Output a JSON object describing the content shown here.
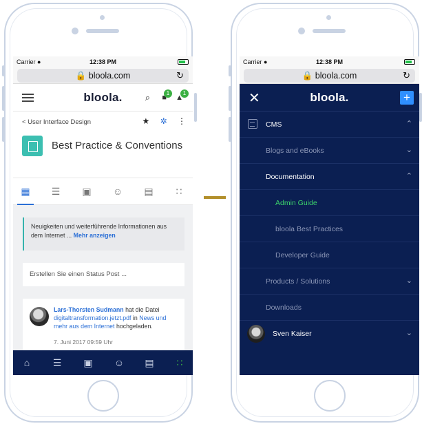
{
  "browser": {
    "carrier": "Carrier ●",
    "time": "12:38 PM",
    "url": "🔒 bloola.com",
    "reload": "↻"
  },
  "left_screen": {
    "logo": "bloola.",
    "header_icons": {
      "search": "⌕",
      "chat": "■",
      "chat_badge": "1",
      "bell": "▲",
      "bell_badge": "1"
    },
    "breadcrumb": "< User Interface Design",
    "crumb_icons": {
      "star": "★",
      "pin": "✲",
      "more": "⋮"
    },
    "page_title": "Best Practice & Conventions",
    "tabs": [
      {
        "icon": "dashboard-icon",
        "glyph": "▦"
      },
      {
        "icon": "list-icon",
        "glyph": "☰"
      },
      {
        "icon": "calendar-icon",
        "glyph": "▣"
      },
      {
        "icon": "people-icon",
        "glyph": "☺"
      },
      {
        "icon": "document-icon",
        "glyph": "▤"
      },
      {
        "icon": "apps-icon",
        "glyph": "∷"
      }
    ],
    "notice": {
      "text": "Neuigkeiten und weiterführende Informationen aus dem Internet ...",
      "link": "Mehr anzeigen"
    },
    "status_input_placeholder": "Erstellen Sie einen Status Post ...",
    "post": {
      "author": "Lars-Thorsten Sudmann",
      "text1": " hat die Datei ",
      "file": "digitaltransformation.jetzt.pdf",
      "text2": " in ",
      "target": "News und mehr aus dem Internet",
      "text3": " hochgeladen.",
      "date": "7. Juni 2017 09:59 Uhr"
    },
    "bottom_tabs": [
      {
        "icon": "home-icon",
        "glyph": "⌂"
      },
      {
        "icon": "list-icon",
        "glyph": "☰"
      },
      {
        "icon": "calendar-icon",
        "glyph": "▣"
      },
      {
        "icon": "people-icon",
        "glyph": "☺"
      },
      {
        "icon": "document-icon",
        "glyph": "▤"
      },
      {
        "icon": "apps-icon",
        "glyph": "∷"
      }
    ]
  },
  "right_screen": {
    "logo": "bloola.",
    "close": "✕",
    "plus": "+",
    "menu": {
      "cms": "CMS",
      "blogs": "Blogs and eBooks",
      "documentation": "Documentation",
      "admin_guide": "Admin Guide",
      "best_practices": "bloola Best Practices",
      "developer_guide": "Developer Guide",
      "products": "Products / Solutions",
      "downloads": "Downloads",
      "user": "Sven Kaiser"
    },
    "chevron_up": "⌃",
    "chevron_down": "⌄"
  },
  "colors": {
    "navy": "#0b1f52",
    "accent_green": "#3cb043",
    "active_link_green": "#3cd36b",
    "link_blue": "#2b6fd6",
    "teal": "#3cbfb1",
    "connector_gold": "#b28f2b"
  }
}
